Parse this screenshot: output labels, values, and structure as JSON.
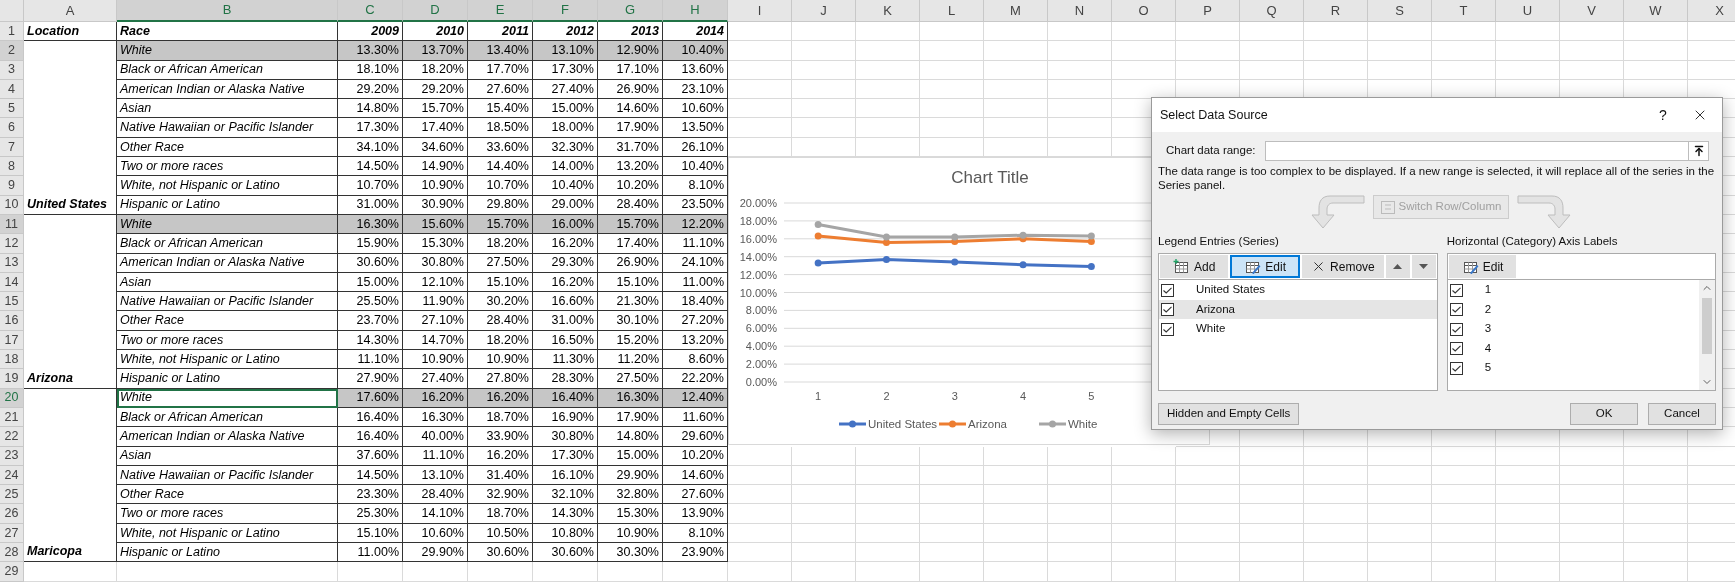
{
  "sheet": {
    "columns": [
      {
        "label": "A",
        "selected": false
      },
      {
        "label": "B",
        "selected": true
      },
      {
        "label": "C",
        "selected": true
      },
      {
        "label": "D",
        "selected": true
      },
      {
        "label": "E",
        "selected": true
      },
      {
        "label": "F",
        "selected": true
      },
      {
        "label": "G",
        "selected": true
      },
      {
        "label": "H",
        "selected": true
      },
      {
        "label": "I",
        "selected": false
      },
      {
        "label": "J",
        "selected": false
      },
      {
        "label": "K",
        "selected": false
      },
      {
        "label": "L",
        "selected": false
      },
      {
        "label": "M",
        "selected": false
      },
      {
        "label": "N",
        "selected": false
      },
      {
        "label": "O",
        "selected": false
      },
      {
        "label": "P",
        "selected": false
      },
      {
        "label": "Q",
        "selected": false
      },
      {
        "label": "R",
        "selected": false
      },
      {
        "label": "S",
        "selected": false
      },
      {
        "label": "T",
        "selected": false
      },
      {
        "label": "U",
        "selected": false
      },
      {
        "label": "V",
        "selected": false
      },
      {
        "label": "W",
        "selected": false
      },
      {
        "label": "X",
        "selected": false
      }
    ],
    "header_row": {
      "number": "1",
      "cells": [
        "Location",
        "Race",
        "2009",
        "2010",
        "2011",
        "2012",
        "2013",
        "2014"
      ]
    },
    "groups": [
      {
        "location": "United States",
        "rows": [
          {
            "number": "2",
            "race": "White",
            "values": [
              "13.30%",
              "13.70%",
              "13.40%",
              "13.10%",
              "12.90%",
              "10.40%"
            ],
            "selected": true,
            "active": false
          },
          {
            "number": "3",
            "race": "Black or African American",
            "values": [
              "18.10%",
              "18.20%",
              "17.70%",
              "17.30%",
              "17.10%",
              "13.60%"
            ],
            "selected": false,
            "active": false
          },
          {
            "number": "4",
            "race": "American Indian or Alaska Native",
            "values": [
              "29.20%",
              "29.20%",
              "27.60%",
              "27.40%",
              "26.90%",
              "23.10%"
            ],
            "selected": false,
            "active": false
          },
          {
            "number": "5",
            "race": "Asian",
            "values": [
              "14.80%",
              "15.70%",
              "15.40%",
              "15.00%",
              "14.60%",
              "10.60%"
            ],
            "selected": false,
            "active": false
          },
          {
            "number": "6",
            "race": "Native Hawaiian or Pacific Islander",
            "values": [
              "17.30%",
              "17.40%",
              "18.50%",
              "18.00%",
              "17.90%",
              "13.50%"
            ],
            "selected": false,
            "active": false
          },
          {
            "number": "7",
            "race": "Other Race",
            "values": [
              "34.10%",
              "34.60%",
              "33.60%",
              "32.30%",
              "31.70%",
              "26.10%"
            ],
            "selected": false,
            "active": false
          },
          {
            "number": "8",
            "race": "Two or more races",
            "values": [
              "14.50%",
              "14.90%",
              "14.40%",
              "14.00%",
              "13.20%",
              "10.40%"
            ],
            "selected": false,
            "active": false
          },
          {
            "number": "9",
            "race": "White, not Hispanic or Latino",
            "values": [
              "10.70%",
              "10.90%",
              "10.70%",
              "10.40%",
              "10.20%",
              "8.10%"
            ],
            "selected": false,
            "active": false
          },
          {
            "number": "10",
            "race": "Hispanic or Latino",
            "values": [
              "31.00%",
              "30.90%",
              "29.80%",
              "29.00%",
              "28.40%",
              "23.50%"
            ],
            "selected": false,
            "active": false
          }
        ]
      },
      {
        "location": "Arizona",
        "rows": [
          {
            "number": "11",
            "race": "White",
            "values": [
              "16.30%",
              "15.60%",
              "15.70%",
              "16.00%",
              "15.70%",
              "12.20%"
            ],
            "selected": true,
            "active": false
          },
          {
            "number": "12",
            "race": "Black or African American",
            "values": [
              "15.90%",
              "15.30%",
              "18.20%",
              "16.20%",
              "17.40%",
              "11.10%"
            ],
            "selected": false,
            "active": false
          },
          {
            "number": "13",
            "race": "American Indian or Alaska Native",
            "values": [
              "30.60%",
              "30.80%",
              "27.50%",
              "29.30%",
              "26.90%",
              "24.10%"
            ],
            "selected": false,
            "active": false
          },
          {
            "number": "14",
            "race": "Asian",
            "values": [
              "15.00%",
              "12.10%",
              "15.10%",
              "16.20%",
              "15.10%",
              "11.00%"
            ],
            "selected": false,
            "active": false
          },
          {
            "number": "15",
            "race": "Native Hawaiian or Pacific Islander",
            "values": [
              "25.50%",
              "11.90%",
              "30.20%",
              "16.60%",
              "21.30%",
              "18.40%"
            ],
            "selected": false,
            "active": false
          },
          {
            "number": "16",
            "race": "Other Race",
            "values": [
              "23.70%",
              "27.10%",
              "28.40%",
              "31.00%",
              "30.10%",
              "27.20%"
            ],
            "selected": false,
            "active": false
          },
          {
            "number": "17",
            "race": "Two or more races",
            "values": [
              "14.30%",
              "14.70%",
              "18.20%",
              "16.50%",
              "15.20%",
              "13.20%"
            ],
            "selected": false,
            "active": false
          },
          {
            "number": "18",
            "race": "White, not Hispanic or Latino",
            "values": [
              "11.10%",
              "10.90%",
              "10.90%",
              "11.30%",
              "11.20%",
              "8.60%"
            ],
            "selected": false,
            "active": false
          },
          {
            "number": "19",
            "race": "Hispanic or Latino",
            "values": [
              "27.90%",
              "27.40%",
              "27.80%",
              "28.30%",
              "27.50%",
              "22.20%"
            ],
            "selected": false,
            "active": false
          }
        ]
      },
      {
        "location": "Maricopa",
        "rows": [
          {
            "number": "20",
            "race": "White",
            "values": [
              "17.60%",
              "16.20%",
              "16.20%",
              "16.40%",
              "16.30%",
              "12.40%"
            ],
            "selected": true,
            "active": true
          },
          {
            "number": "21",
            "race": "Black or African American",
            "values": [
              "16.40%",
              "16.30%",
              "18.70%",
              "16.90%",
              "17.90%",
              "11.60%"
            ],
            "selected": false,
            "active": false
          },
          {
            "number": "22",
            "race": "American Indian or Alaska Native",
            "values": [
              "16.40%",
              "40.00%",
              "33.90%",
              "30.80%",
              "14.80%",
              "29.60%"
            ],
            "selected": false,
            "active": false
          },
          {
            "number": "23",
            "race": "Asian",
            "values": [
              "37.60%",
              "11.10%",
              "16.20%",
              "17.30%",
              "15.00%",
              "10.20%"
            ],
            "selected": false,
            "active": false
          },
          {
            "number": "24",
            "race": "Native Hawaiian or Pacific Islander",
            "values": [
              "14.50%",
              "13.10%",
              "31.40%",
              "16.10%",
              "29.90%",
              "14.60%"
            ],
            "selected": false,
            "active": false
          },
          {
            "number": "25",
            "race": "Other Race",
            "values": [
              "23.30%",
              "28.40%",
              "32.90%",
              "32.10%",
              "32.80%",
              "27.60%"
            ],
            "selected": false,
            "active": false
          },
          {
            "number": "26",
            "race": "Two or more races",
            "values": [
              "25.30%",
              "14.10%",
              "18.70%",
              "14.30%",
              "15.30%",
              "13.90%"
            ],
            "selected": false,
            "active": false
          },
          {
            "number": "27",
            "race": "White, not Hispanic or Latino",
            "values": [
              "15.10%",
              "10.60%",
              "10.50%",
              "10.80%",
              "10.90%",
              "8.10%"
            ],
            "selected": false,
            "active": false
          },
          {
            "number": "28",
            "race": "Hispanic or Latino",
            "values": [
              "11.00%",
              "29.90%",
              "30.60%",
              "30.60%",
              "30.30%",
              "23.90%"
            ],
            "selected": false,
            "active": false
          }
        ]
      }
    ],
    "blank_rows": [
      "29"
    ]
  },
  "chart": {
    "chart_data": {
      "type": "line",
      "title": "Chart Title",
      "grid": true,
      "legend": "bottom",
      "categories": [
        "1",
        "2",
        "3",
        "4",
        "5"
      ],
      "ylim": [
        0,
        20
      ],
      "yticks": [
        {
          "value": 0,
          "label": "0.00%"
        },
        {
          "value": 2,
          "label": "2.00%"
        },
        {
          "value": 4,
          "label": "4.00%"
        },
        {
          "value": 6,
          "label": "6.00%"
        },
        {
          "value": 8,
          "label": "8.00%"
        },
        {
          "value": 10,
          "label": "10.00%"
        },
        {
          "value": 12,
          "label": "12.00%"
        },
        {
          "value": 14,
          "label": "14.00%"
        },
        {
          "value": 16,
          "label": "16.00%"
        },
        {
          "value": 18,
          "label": "18.00%"
        },
        {
          "value": 20,
          "label": "20.00%"
        }
      ],
      "series": [
        {
          "name": "United States",
          "color": "#4472c4",
          "marker": "circle",
          "values": [
            13.3,
            13.7,
            13.4,
            13.1,
            12.9
          ]
        },
        {
          "name": "Arizona",
          "color": "#ed7d31",
          "marker": "circle",
          "values": [
            16.3,
            15.6,
            15.7,
            16.0,
            15.7
          ]
        },
        {
          "name": "White",
          "color": "#a5a5a5",
          "marker": "circle",
          "values": [
            17.6,
            16.2,
            16.2,
            16.4,
            16.3
          ]
        }
      ]
    }
  },
  "dialog": {
    "title": "Select Data Source",
    "help": "?",
    "range_label": "Chart data range:",
    "message": "The data range is too complex to be displayed. If a new range is selected, it will replace all of the series in the Series panel.",
    "switch_button": {
      "label": "Switch Row/Column",
      "disabled": true
    },
    "series_panel": {
      "label": "Legend Entries (Series)",
      "buttons": [
        {
          "kind": "add",
          "label": "Add",
          "focused": false
        },
        {
          "kind": "edit",
          "label": "Edit",
          "focused": true
        },
        {
          "kind": "remove",
          "label": "Remove",
          "focused": false
        },
        {
          "kind": "up",
          "focused": false
        },
        {
          "kind": "down",
          "focused": false
        }
      ],
      "items": [
        {
          "label": "United States",
          "checked": true,
          "selected": false
        },
        {
          "label": "Arizona",
          "checked": true,
          "selected": true
        },
        {
          "label": "White",
          "checked": true,
          "selected": false
        }
      ]
    },
    "axis_panel": {
      "label": "Horizontal (Category) Axis Labels",
      "buttons": [
        {
          "kind": "edit",
          "label": "Edit",
          "focused": false
        }
      ],
      "items": [
        {
          "label": "1",
          "checked": true,
          "selected": false
        },
        {
          "label": "2",
          "checked": true,
          "selected": false
        },
        {
          "label": "3",
          "checked": true,
          "selected": false
        },
        {
          "label": "4",
          "checked": true,
          "selected": false
        },
        {
          "label": "5",
          "checked": true,
          "selected": false
        }
      ]
    },
    "footer_buttons": [
      {
        "kind": "left",
        "label": "Hidden and Empty Cells"
      },
      {
        "kind": "right",
        "label": "OK"
      },
      {
        "kind": "right",
        "label": "Cancel"
      }
    ]
  }
}
